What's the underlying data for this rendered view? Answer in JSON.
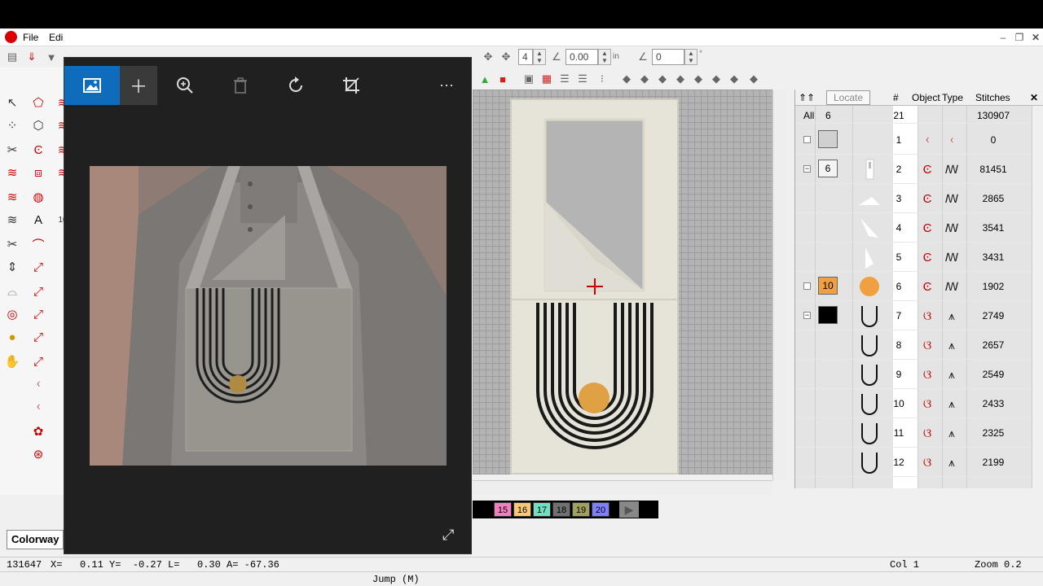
{
  "menu": {
    "file": "File",
    "edit": "Edi"
  },
  "toolbar": {
    "field_a": "4",
    "field_b": "0.00",
    "unit": "in",
    "field_c": "0",
    "degree": "°"
  },
  "panel": {
    "locate": "Locate",
    "col_num": "#",
    "col_object": "Object",
    "col_type": "Type",
    "col_stitches": "Stitches",
    "all_label": "All",
    "all_count": "6",
    "total_num": "21",
    "total_stitches": "130907",
    "rows": [
      {
        "num": "1",
        "stitches": "0",
        "color_label": "",
        "color": "#d0d0d0"
      },
      {
        "num": "2",
        "stitches": "81451",
        "color_label": "6",
        "color": "#f4f4f4"
      },
      {
        "num": "3",
        "stitches": "2865"
      },
      {
        "num": "4",
        "stitches": "3541"
      },
      {
        "num": "5",
        "stitches": "3431"
      },
      {
        "num": "6",
        "stitches": "1902",
        "color_label": "10",
        "color": "#f0a040"
      },
      {
        "num": "7",
        "stitches": "2749",
        "color_label": "",
        "color": "#000000"
      },
      {
        "num": "8",
        "stitches": "2657"
      },
      {
        "num": "9",
        "stitches": "2549"
      },
      {
        "num": "10",
        "stitches": "2433"
      },
      {
        "num": "11",
        "stitches": "2325"
      },
      {
        "num": "12",
        "stitches": "2199"
      }
    ]
  },
  "colorbar": [
    {
      "label": "15",
      "color": "#f080c0"
    },
    {
      "label": "16",
      "color": "#f8c878"
    },
    {
      "label": "17",
      "color": "#70e0c0"
    },
    {
      "label": "18",
      "color": "#707070"
    },
    {
      "label": "19",
      "color": "#a0a060"
    },
    {
      "label": "20",
      "color": "#8080ff"
    }
  ],
  "colorway": "Colorway",
  "status": {
    "stitch_count": "131647",
    "coords": "X=   0.11 Y=  -0.27 L=   0.30 A= -67.36",
    "col": "Col 1",
    "zoom": "Zoom 0.2",
    "mode": "Jump (M)"
  }
}
